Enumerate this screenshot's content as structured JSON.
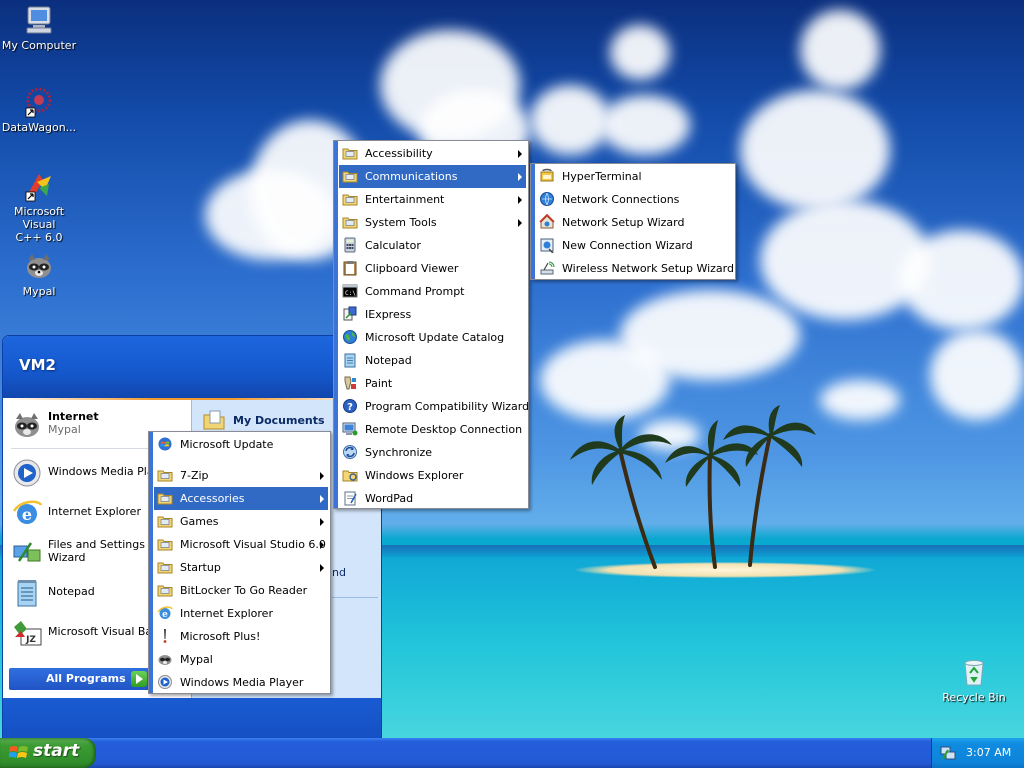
{
  "desktop": {
    "icons": [
      {
        "label": "My Computer",
        "icon": "my-computer-icon"
      },
      {
        "label": "DataWagon...",
        "icon": "datawagon-icon"
      },
      {
        "label": "Microsoft Visual C++ 6.0",
        "line1": "Microsoft Visual",
        "line2": "C++ 6.0",
        "icon": "visual-cpp-icon"
      },
      {
        "label": "Mypal",
        "icon": "mypal-raccoon-icon"
      },
      {
        "label": "Recycle Bin",
        "icon": "recycle-bin-icon"
      }
    ]
  },
  "start_menu": {
    "user": "VM2",
    "pinned": {
      "internet": {
        "title": "Internet",
        "subtitle": "Mypal"
      },
      "my_documents": "My Documents"
    },
    "recent": [
      {
        "label": "Windows Media Playe",
        "icon": "windows-media-player-icon"
      },
      {
        "label": "Internet Explorer",
        "icon": "internet-explorer-icon"
      },
      {
        "label": "Files and Settings Tra",
        "label2": "Wizard",
        "icon": "files-settings-transfer-icon"
      },
      {
        "label": "Notepad",
        "icon": "notepad-icon"
      },
      {
        "label": "Microsoft Visual Basic",
        "icon": "visual-basic-icon"
      }
    ],
    "right_partial_text": "nd",
    "all_programs": "All Programs"
  },
  "programs_menu": [
    {
      "label": "Microsoft Update",
      "icon": "windows-update-icon",
      "submenu": false
    },
    {
      "label": "7-Zip",
      "icon": "folder-icon",
      "submenu": true
    },
    {
      "label": "Accessories",
      "icon": "folder-icon",
      "submenu": true,
      "selected": true
    },
    {
      "label": "Games",
      "icon": "folder-icon",
      "submenu": true
    },
    {
      "label": "Microsoft Visual Studio 6.0",
      "icon": "folder-icon",
      "submenu": true
    },
    {
      "label": "Startup",
      "icon": "folder-icon",
      "submenu": true
    },
    {
      "label": "BitLocker To Go Reader",
      "icon": "folder-icon",
      "submenu": false
    },
    {
      "label": "Internet Explorer",
      "icon": "internet-explorer-icon",
      "submenu": false
    },
    {
      "label": "Microsoft Plus!",
      "icon": "microsoft-plus-icon",
      "submenu": false
    },
    {
      "label": "Mypal",
      "icon": "mypal-raccoon-icon",
      "submenu": false
    },
    {
      "label": "Windows Media Player",
      "icon": "windows-media-player-icon",
      "submenu": false
    }
  ],
  "accessories_menu": [
    {
      "label": "Accessibility",
      "icon": "folder-icon",
      "submenu": true
    },
    {
      "label": "Communications",
      "icon": "folder-icon",
      "submenu": true,
      "selected": true
    },
    {
      "label": "Entertainment",
      "icon": "folder-icon",
      "submenu": true
    },
    {
      "label": "System Tools",
      "icon": "folder-icon",
      "submenu": true
    },
    {
      "label": "Calculator",
      "icon": "calculator-icon",
      "submenu": false
    },
    {
      "label": "Clipboard Viewer",
      "icon": "clipboard-icon",
      "submenu": false
    },
    {
      "label": "Command Prompt",
      "icon": "command-prompt-icon",
      "submenu": false
    },
    {
      "label": "IExpress",
      "icon": "iexpress-icon",
      "submenu": false
    },
    {
      "label": "Microsoft Update Catalog",
      "icon": "globe-icon",
      "submenu": false
    },
    {
      "label": "Notepad",
      "icon": "notepad-icon",
      "submenu": false
    },
    {
      "label": "Paint",
      "icon": "paint-icon",
      "submenu": false
    },
    {
      "label": "Program Compatibility Wizard",
      "icon": "help-icon",
      "submenu": false
    },
    {
      "label": "Remote Desktop Connection",
      "icon": "remote-desktop-icon",
      "submenu": false
    },
    {
      "label": "Synchronize",
      "icon": "synchronize-icon",
      "submenu": false
    },
    {
      "label": "Windows Explorer",
      "icon": "windows-explorer-icon",
      "submenu": false
    },
    {
      "label": "WordPad",
      "icon": "wordpad-icon",
      "submenu": false
    }
  ],
  "communications_menu": [
    {
      "label": "HyperTerminal",
      "icon": "hyperterminal-icon"
    },
    {
      "label": "Network Connections",
      "icon": "network-connections-icon"
    },
    {
      "label": "Network Setup Wizard",
      "icon": "network-setup-wizard-icon"
    },
    {
      "label": "New Connection Wizard",
      "icon": "new-connection-wizard-icon"
    },
    {
      "label": "Wireless Network Setup Wizard",
      "icon": "wireless-network-icon"
    }
  ],
  "taskbar": {
    "start_label": "start",
    "clock": "3:07 AM",
    "tray_icon": "network-tray-icon"
  },
  "colors": {
    "taskbar_blue": "#245edb",
    "start_green": "#3c9b32",
    "menu_highlight": "#316ac5",
    "menu_stripe": "#3b73d6"
  }
}
